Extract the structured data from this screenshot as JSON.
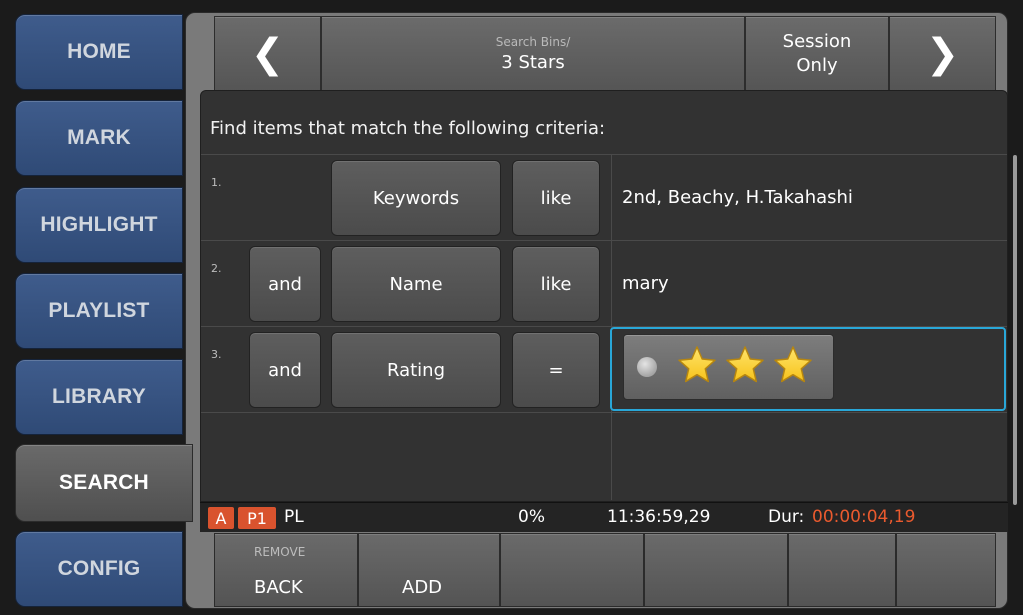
{
  "nav": {
    "tabs": [
      {
        "label": "HOME"
      },
      {
        "label": "MARK"
      },
      {
        "label": "HIGHLIGHT"
      },
      {
        "label": "PLAYLIST"
      },
      {
        "label": "LIBRARY"
      },
      {
        "label": "SEARCH",
        "active": true
      },
      {
        "label": "CONFIG"
      }
    ]
  },
  "header": {
    "back_icon": "chevron-left-icon",
    "forward_icon": "chevron-right-icon",
    "breadcrumb": "Search Bins/",
    "title": "3 Stars",
    "session_label_line1": "Session",
    "session_label_line2": "Only"
  },
  "criteria": {
    "heading": "Find items that match the following criteria:",
    "rows": [
      {
        "num": "1.",
        "conj": "",
        "field": "Keywords",
        "op": "like",
        "value": "2nd, Beachy, H.Takahashi"
      },
      {
        "num": "2.",
        "conj": "and",
        "field": "Name",
        "op": "like",
        "value": "mary"
      },
      {
        "num": "3.",
        "conj": "and",
        "field": "Rating",
        "op": "=",
        "value_rating": 3
      }
    ]
  },
  "status": {
    "badge_a": "A",
    "badge_p1": "P1",
    "mode": "PL",
    "percent": "0%",
    "timecode": "11:36:59,29",
    "dur_label": "Dur:",
    "dur_value": "00:00:04,19"
  },
  "footer": {
    "remove_label": "REMOVE",
    "back_label": "BACK",
    "add_label": "ADD"
  },
  "colors": {
    "tab_blue": "#3f5c8c",
    "accent_orange": "#ea5a2e",
    "selection_blue": "#29a7d8",
    "star_yellow": "#f6c21a"
  }
}
